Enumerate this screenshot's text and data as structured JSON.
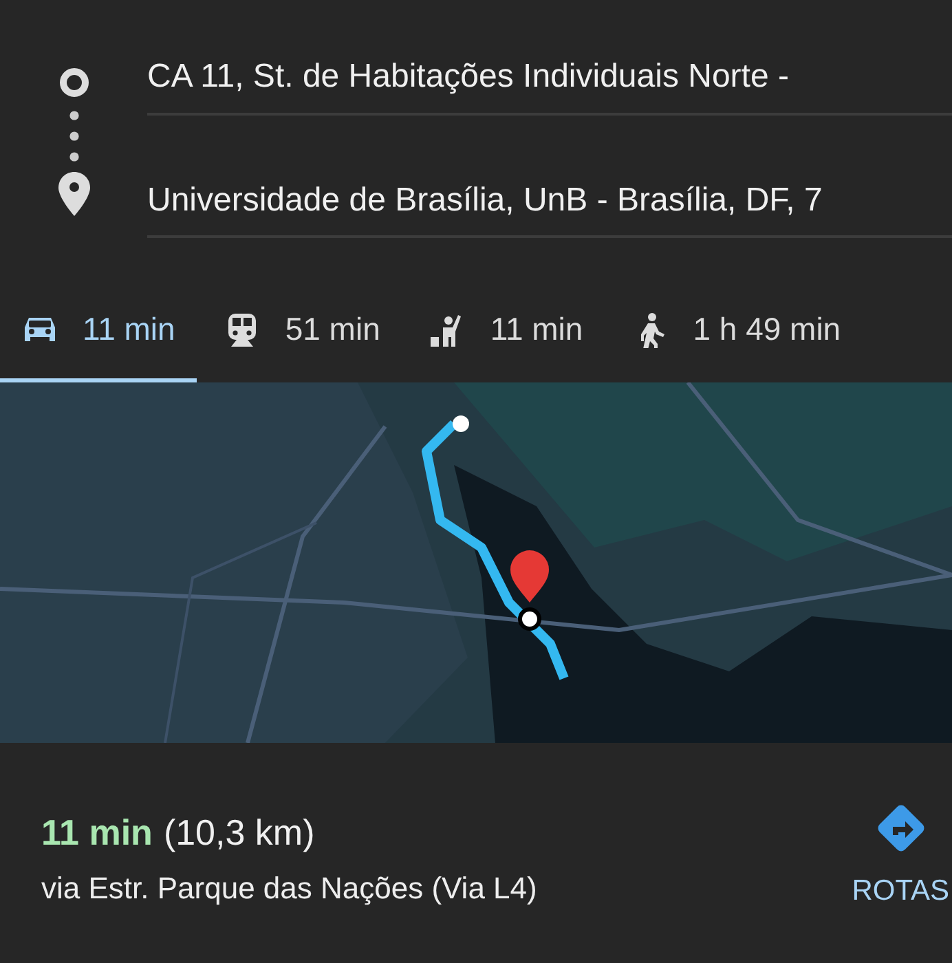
{
  "route": {
    "origin": "CA 11, St. de Habitações Individuais Norte -",
    "destination": "Universidade de Brasília, UnB - Brasília, DF, 7"
  },
  "modes": [
    {
      "kind": "car",
      "label": "11 min",
      "selected": true
    },
    {
      "kind": "train",
      "label": "51 min",
      "selected": false
    },
    {
      "kind": "taxi",
      "label": "11 min",
      "selected": false
    },
    {
      "kind": "walk",
      "label": "1 h 49 min",
      "selected": false
    }
  ],
  "summary": {
    "duration": "11 min",
    "distance": "(10,3 km)",
    "via": "via Estr. Parque das Nações (Via L4)",
    "action": "ROTAS"
  }
}
